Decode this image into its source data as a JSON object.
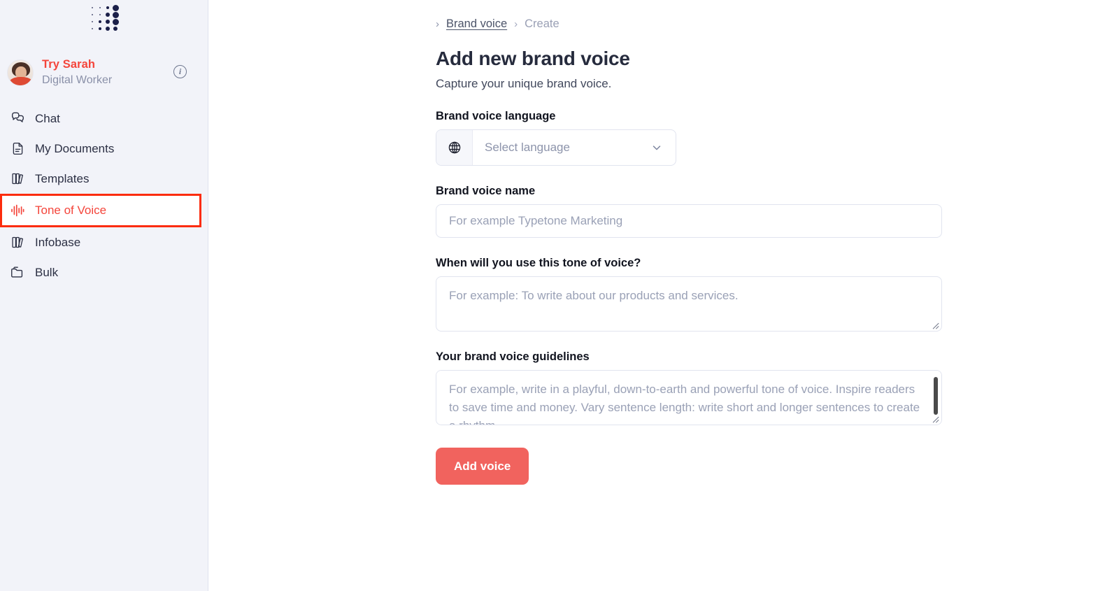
{
  "sidebar": {
    "logo": {
      "icon": "typetone-dot-grid-logo"
    },
    "profile": {
      "name": "Try Sarah",
      "role": "Digital Worker",
      "info_icon": "info-circle-icon",
      "avatar_icon": "user-avatar-photo"
    },
    "items": [
      {
        "label": "Chat",
        "icon": "chat-bubbles-icon",
        "active": false
      },
      {
        "label": "My Documents",
        "icon": "document-icon",
        "active": false
      },
      {
        "label": "Templates",
        "icon": "books-icon",
        "active": false
      },
      {
        "label": "Tone of Voice",
        "icon": "waveform-icon",
        "active": true
      },
      {
        "label": "Infobase",
        "icon": "books-icon",
        "active": false
      },
      {
        "label": "Bulk",
        "icon": "folder-icon",
        "active": false
      }
    ]
  },
  "breadcrumb": {
    "leading_chevron": "chevron-right-icon",
    "parent": "Brand voice",
    "separator": "chevron-right-icon",
    "current": "Create"
  },
  "header": {
    "title": "Add new brand voice",
    "subtitle": "Capture your unique brand voice."
  },
  "form": {
    "language": {
      "label": "Brand voice language",
      "placeholder": "Select language",
      "value": "",
      "prefix_icon": "globe-icon",
      "chevron_icon": "chevron-down-icon"
    },
    "name": {
      "label": "Brand voice name",
      "placeholder": "For example Typetone Marketing",
      "value": ""
    },
    "usecase": {
      "label": "When will you use this tone of voice?",
      "placeholder": "For example: To write about our products and services.",
      "value": ""
    },
    "guidelines": {
      "label": "Your brand voice guidelines",
      "placeholder": "For example, write in a playful, down-to-earth and powerful tone of voice. Inspire readers to save time and money. Vary sentence length: write short and longer sentences to create a rhythm.",
      "value": ""
    },
    "submit_label": "Add voice"
  },
  "colors": {
    "brand_red": "#F4453B",
    "button_red": "#F1635E",
    "highlight_red": "#FC2C0D",
    "sidebar_bg": "#F2F3F9",
    "logo_navy": "#1B1F49",
    "text_dark": "#262B3D",
    "muted": "#8A90A8",
    "border": "#E1E4EF"
  }
}
